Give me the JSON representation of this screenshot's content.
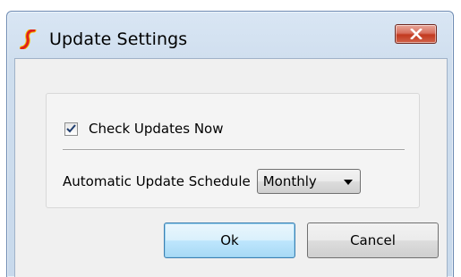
{
  "window": {
    "title": "Update Settings",
    "app_icon": "simetrix-logo-icon",
    "close_icon": "close-x-icon"
  },
  "settings": {
    "check_updates_label": "Check Updates Now",
    "check_updates_checked": true,
    "schedule_label": "Automatic Update Schedule",
    "schedule_value": "Monthly"
  },
  "buttons": {
    "ok_label": "Ok",
    "cancel_label": "Cancel"
  },
  "colors": {
    "title_bar": "#cfdeee",
    "close_button": "#c2391f",
    "ok_button_accent": "#3c7fb1",
    "logo_red": "#e0201b",
    "logo_yellow": "#f5c400"
  }
}
